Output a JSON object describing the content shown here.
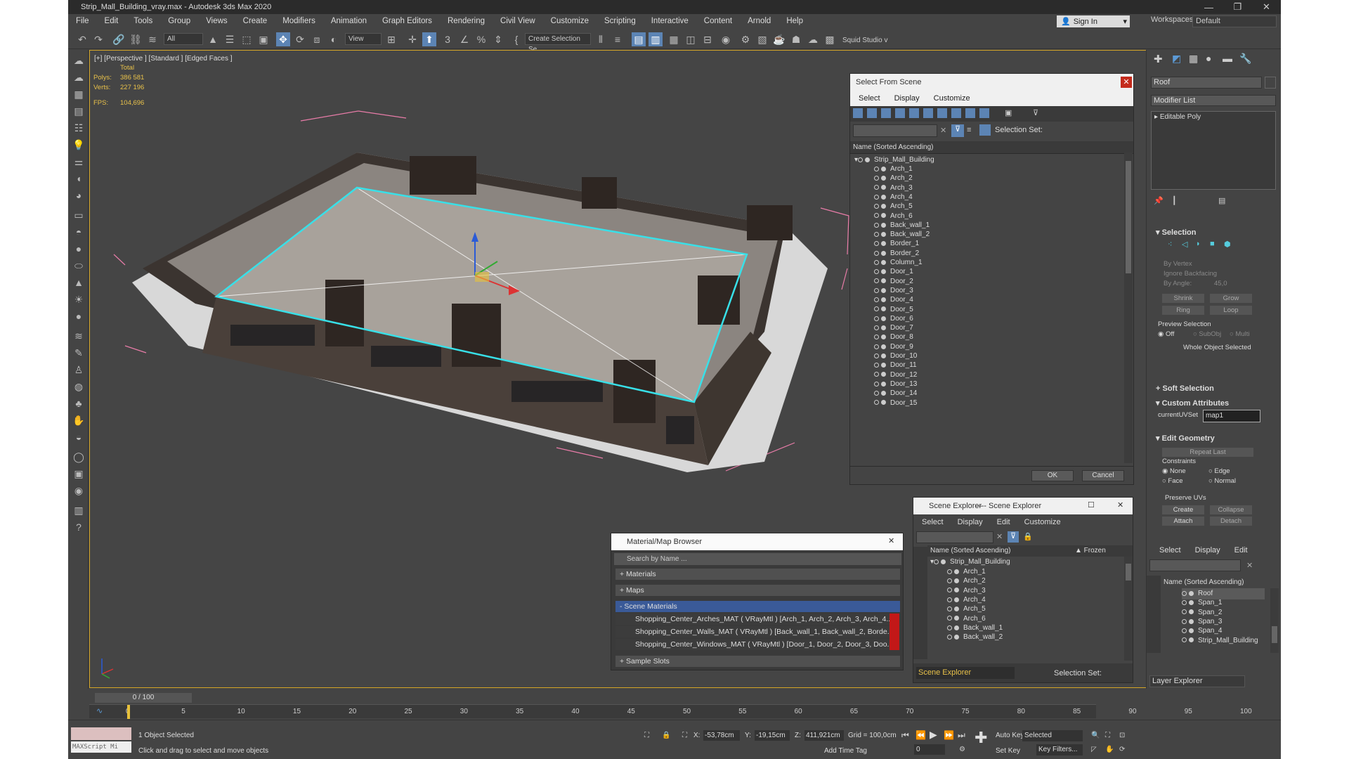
{
  "window": {
    "title": "Strip_Mall_Building_vray.max - Autodesk 3ds Max 2020",
    "controls": [
      "—",
      "❐",
      "✕"
    ]
  },
  "menu": [
    "File",
    "Edit",
    "Tools",
    "Group",
    "Views",
    "Create",
    "Modifiers",
    "Animation",
    "Graph Editors",
    "Rendering",
    "Civil View",
    "Customize",
    "Scripting",
    "Interactive",
    "Content",
    "Arnold",
    "Help"
  ],
  "signin": "Sign In",
  "workspace": {
    "label": "Workspaces:",
    "value": "Default"
  },
  "toolbar": {
    "filter": "All",
    "refcoord": "View",
    "selset": "Create Selection Se",
    "squid": "Squid Studio v"
  },
  "viewport": {
    "label": "[+] [Perspective ] [Standard ] [Edged Faces ]",
    "stats": {
      "total": "Total",
      "polys_label": "Polys:",
      "polys": "386 581",
      "verts_label": "Verts:",
      "verts": "227 196",
      "fps_label": "FPS:",
      "fps": "104,696"
    },
    "axes": {
      "x": "x",
      "y": "y",
      "z": "z"
    }
  },
  "select_from_scene": {
    "title": "Select From Scene",
    "menu": [
      "Select",
      "Display",
      "Customize"
    ],
    "selection_set_label": "Selection Set:",
    "column": "Name (Sorted Ascending)",
    "root": "Strip_Mall_Building",
    "items": [
      "Arch_1",
      "Arch_2",
      "Arch_3",
      "Arch_4",
      "Arch_5",
      "Arch_6",
      "Back_wall_1",
      "Back_wall_2",
      "Border_1",
      "Border_2",
      "Column_1",
      "Door_1",
      "Door_2",
      "Door_3",
      "Door_4",
      "Door_5",
      "Door_6",
      "Door_7",
      "Door_8",
      "Door_9",
      "Door_10",
      "Door_11",
      "Door_12",
      "Door_13",
      "Door_14",
      "Door_15"
    ],
    "ok": "OK",
    "cancel": "Cancel"
  },
  "scene_explorer": {
    "title": "Scene Explorer - Scene Explorer",
    "menu": [
      "Select",
      "Display",
      "Edit",
      "Customize"
    ],
    "column": "Name (Sorted Ascending)",
    "frozen": "▲ Frozen",
    "root": "Strip_Mall_Building",
    "items": [
      "Arch_1",
      "Arch_2",
      "Arch_3",
      "Arch_4",
      "Arch_5",
      "Arch_6",
      "Back_wall_1",
      "Back_wall_2"
    ],
    "footer_name": "Scene Explorer",
    "footer_set": "Selection Set:"
  },
  "material_browser": {
    "title": "Material/Map Browser",
    "search": "Search by Name ...",
    "materials": "+ Materials",
    "maps": "+ Maps",
    "scene_materials": "- Scene Materials",
    "mats": [
      "Shopping_Center_Arches_MAT  ( VRayMtl )  [Arch_1, Arch_2, Arch_3, Arch_4...",
      "Shopping_Center_Walls_MAT  ( VRayMtl )  [Back_wall_1, Back_wall_2, Borde...",
      "Shopping_Center_Windows_MAT  ( VRayMtl )  [Door_1, Door_2, Door_3, Doo..."
    ],
    "sample_slots": "+ Sample Slots"
  },
  "command_panel": {
    "object_name": "Roof",
    "modifier_list": "Modifier List",
    "stack_item": "Editable Poly",
    "selection": "Selection",
    "by_vertex": "By Vertex",
    "ignore_backfacing": "Ignore Backfacing",
    "by_angle": "By Angle:",
    "angle": "45,0",
    "shrink": "Shrink",
    "grow": "Grow",
    "ring": "Ring",
    "loop": "Loop",
    "preview_selection": "Preview Selection",
    "off": "Off",
    "subobj": "SubObj",
    "multi": "Multi",
    "whole": "Whole Object Selected",
    "soft": "Soft Selection",
    "custom_attr": "Custom Attributes",
    "uvset_label": "currentUVSet",
    "uvset": "map1",
    "edit_geometry": "Edit Geometry",
    "repeat_last": "Repeat Last",
    "constraints": "Constraints",
    "none": "None",
    "edge": "Edge",
    "face": "Face",
    "normal": "Normal",
    "preserve_uvs": "Preserve UVs",
    "create": "Create",
    "collapse": "Collapse",
    "attach": "Attach",
    "detach": "Detach"
  },
  "layer_explorer": {
    "menu": [
      "Select",
      "Display",
      "Edit"
    ],
    "column": "Name (Sorted Ascending)",
    "items": [
      "Roof",
      "Span_1",
      "Span_2",
      "Span_3",
      "Span_4",
      "Strip_Mall_Building"
    ],
    "footer": "Layer Explorer"
  },
  "timeline": {
    "frame": "0 / 100",
    "ticks": [
      "0",
      "5",
      "10",
      "15",
      "20",
      "25",
      "30",
      "35",
      "40",
      "45",
      "50",
      "55",
      "60",
      "65",
      "70",
      "75",
      "80",
      "85",
      "90",
      "95",
      "100"
    ]
  },
  "status": {
    "maxscript": "MAXScript Mi",
    "selected": "1 Object Selected",
    "prompt": "Click and drag to select and move objects",
    "x_label": "X:",
    "x": "-53,78cm",
    "y_label": "Y:",
    "y": "-19,15cm",
    "z_label": "Z:",
    "z": "411,921cm",
    "grid": "Grid = 100,0cm",
    "add_time_tag": "Add Time Tag",
    "frame": "0",
    "auto_key": "Auto Key",
    "set_key": "Set Key",
    "selected_dd": "Selected",
    "key_filters": "Key Filters..."
  },
  "colors": {
    "accent": "#5c84b4",
    "viewport_border": "#d4a526",
    "stats": "#e8c14a",
    "roof_sel": "#38e0e8",
    "bbox": "#e87ca8"
  }
}
